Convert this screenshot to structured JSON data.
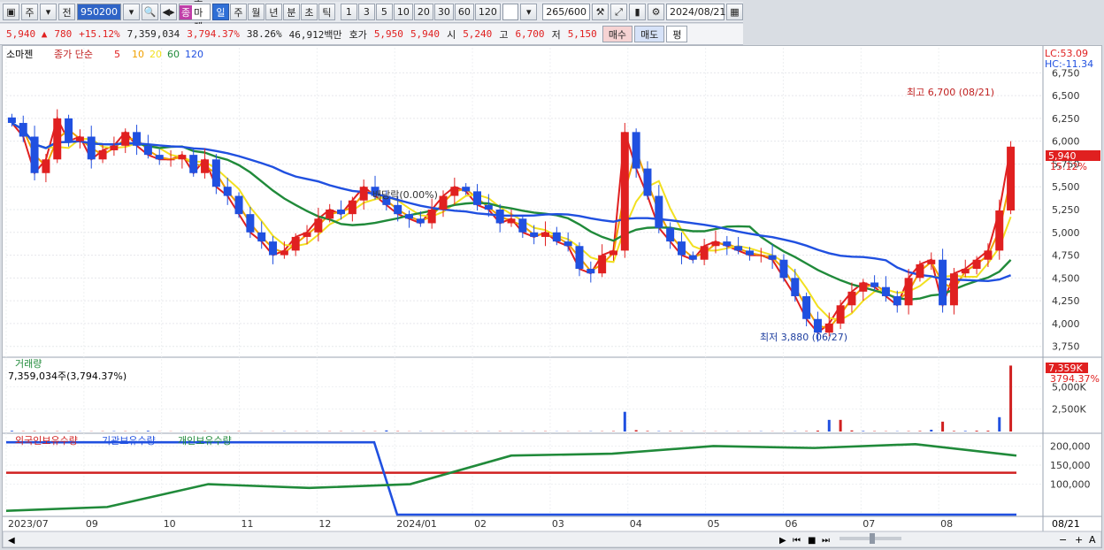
{
  "toolbar": {
    "period_buttons": [
      "일",
      "주",
      "월",
      "년",
      "분",
      "초",
      "틱"
    ],
    "active_period": "일",
    "interval_buttons": [
      "1",
      "3",
      "5",
      "10",
      "20",
      "30",
      "60",
      "120"
    ],
    "code": "950200",
    "name": "소마젠",
    "type_badge": "종",
    "prefix1": "주",
    "prefix2": "전",
    "count": "265",
    "count_total": "/600",
    "date": "2024/08/21"
  },
  "quote": {
    "price": "5,940",
    "arrow": "▲",
    "change": "780",
    "change_pct": "+15.12%",
    "volume": "7,359,034",
    "vol_ratio": "3,794.37%",
    "turnover": "38.26%",
    "amount": "46,912백만",
    "bid_label": "호가",
    "bid1": "5,950",
    "bid2": "5,940",
    "open_label": "시",
    "open": "5,240",
    "high_label": "고",
    "high": "6,700",
    "low_label": "저",
    "low": "5,150",
    "buy": "매수",
    "sell": "매도",
    "even": "평"
  },
  "legend": {
    "name": "소마젠",
    "ma_label": "종가 단순",
    "periods": [
      "5",
      "10",
      "20",
      "60",
      "120"
    ],
    "colors": [
      "#e02020",
      "#f0a000",
      "#f2e020",
      "#208a3a",
      "#2050e0"
    ]
  },
  "lc_hc": {
    "lc": "LC:53.09",
    "hc": "HC:-11.34"
  },
  "annotations": {
    "high": "최고 6,700 (08/21)",
    "low": "최저 3,880 (06/27)",
    "dividend": "배당락(0.00%)",
    "last_price": "5,940",
    "last_pct": "15.12%"
  },
  "volume_panel": {
    "title": "거래량",
    "value": "7,359,034주(3,794.37%)",
    "last": "7,359K",
    "last_pct": "3794.37%"
  },
  "holding_panel": {
    "labels": [
      "외국인보유수량",
      "기관보유수량",
      "개인보유수량"
    ],
    "colors": [
      "#d02020",
      "#2050e0",
      "#208a3a"
    ]
  },
  "x_labels": [
    "2023/07",
    "09",
    "10",
    "11",
    "12",
    "2024/01",
    "02",
    "03",
    "04",
    "05",
    "06",
    "07",
    "08"
  ],
  "x_right": "08/21",
  "chart_data": [
    {
      "type": "candlestick",
      "title": "소마젠",
      "yticks": [
        3750,
        4000,
        4250,
        4500,
        4750,
        5000,
        5250,
        5500,
        5750,
        6000,
        6250,
        6500,
        6750
      ],
      "ylim": [
        3650,
        6850
      ],
      "close": [
        6200,
        6050,
        5650,
        5800,
        6250,
        6000,
        6050,
        5800,
        5900,
        5950,
        6100,
        5950,
        5850,
        5800,
        5800,
        5850,
        5650,
        5800,
        5500,
        5400,
        5200,
        5000,
        4900,
        4750,
        4800,
        4950,
        5000,
        5150,
        5250,
        5200,
        5350,
        5500,
        5400,
        5300,
        5200,
        5150,
        5100,
        5250,
        5400,
        5500,
        5450,
        5300,
        5250,
        5100,
        5150,
        5000,
        4950,
        5000,
        4900,
        4850,
        4600,
        4550,
        4750,
        4800,
        6100,
        5700,
        5400,
        5050,
        4900,
        4750,
        4700,
        4850,
        4900,
        4850,
        4800,
        4750,
        4750,
        4700,
        4500,
        4300,
        4050,
        3900,
        4000,
        4200,
        4350,
        4450,
        4400,
        4300,
        4200,
        4500,
        4650,
        4700,
        4200,
        4550,
        4600,
        4700,
        4800,
        5240,
        5940
      ],
      "volume_k": [
        80,
        30,
        40,
        20,
        30,
        30,
        20,
        20,
        30,
        40,
        30,
        20,
        80,
        20,
        20,
        20,
        20,
        30,
        20,
        20,
        30,
        20,
        20,
        20,
        30,
        20,
        20,
        20,
        30,
        30,
        20,
        30,
        30,
        120,
        40,
        20,
        30,
        20,
        20,
        20,
        20,
        20,
        20,
        30,
        20,
        20,
        20,
        30,
        20,
        20,
        20,
        30,
        30,
        40,
        2200,
        150,
        60,
        40,
        40,
        30,
        20,
        20,
        20,
        20,
        20,
        20,
        30,
        20,
        20,
        30,
        40,
        100,
        1300,
        1300,
        120,
        60,
        40,
        30,
        30,
        40,
        60,
        200,
        1100,
        60,
        60,
        90,
        90,
        1600,
        7359
      ]
    },
    {
      "type": "bar",
      "title": "거래량",
      "yticks": [
        2500,
        5000
      ],
      "ytick_labels": [
        "2,500K",
        "5,000K"
      ],
      "ylim": [
        0,
        7500
      ]
    },
    {
      "type": "line",
      "series": [
        {
          "name": "외국인보유수량",
          "values": [
            130000,
            130000
          ]
        },
        {
          "name": "기관보유수량",
          "values": [
            210000,
            210000,
            20000,
            20000
          ]
        },
        {
          "name": "개인보유수량",
          "values": [
            30000,
            40000,
            100000,
            90000,
            100000,
            175000,
            180000,
            200000,
            195000,
            205000,
            175000
          ]
        }
      ],
      "yticks": [
        100000,
        150000,
        200000
      ],
      "ytick_labels": [
        "100,000",
        "150,000",
        "200,000"
      ],
      "ylim": [
        20000,
        215000
      ]
    }
  ]
}
